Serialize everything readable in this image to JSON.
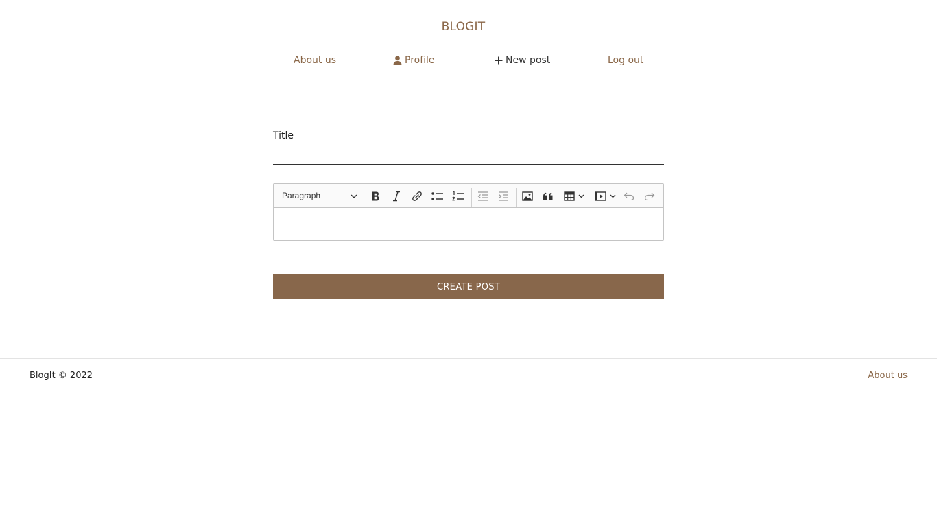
{
  "header": {
    "brand": "BLOGIT",
    "nav": {
      "about": "About us",
      "profile": "Profile",
      "new_post": "New post",
      "logout": "Log out"
    }
  },
  "form": {
    "title_label": "Title",
    "title_value": "",
    "editor": {
      "block_format": "Paragraph",
      "tools": [
        "bold-icon",
        "italic-icon",
        "link-icon",
        "bulleted-list-icon",
        "numbered-list-icon",
        "outdent-icon",
        "indent-icon",
        "image-icon",
        "quote-icon",
        "table-icon",
        "media-icon",
        "undo-icon",
        "redo-icon"
      ],
      "content": ""
    },
    "submit_label": "CREATE POST"
  },
  "footer": {
    "copyright": "BlogIt © 2022",
    "about_link": "About us"
  },
  "colors": {
    "accent": "#88674b",
    "link": "#8a6748",
    "active_link": "#333333"
  }
}
